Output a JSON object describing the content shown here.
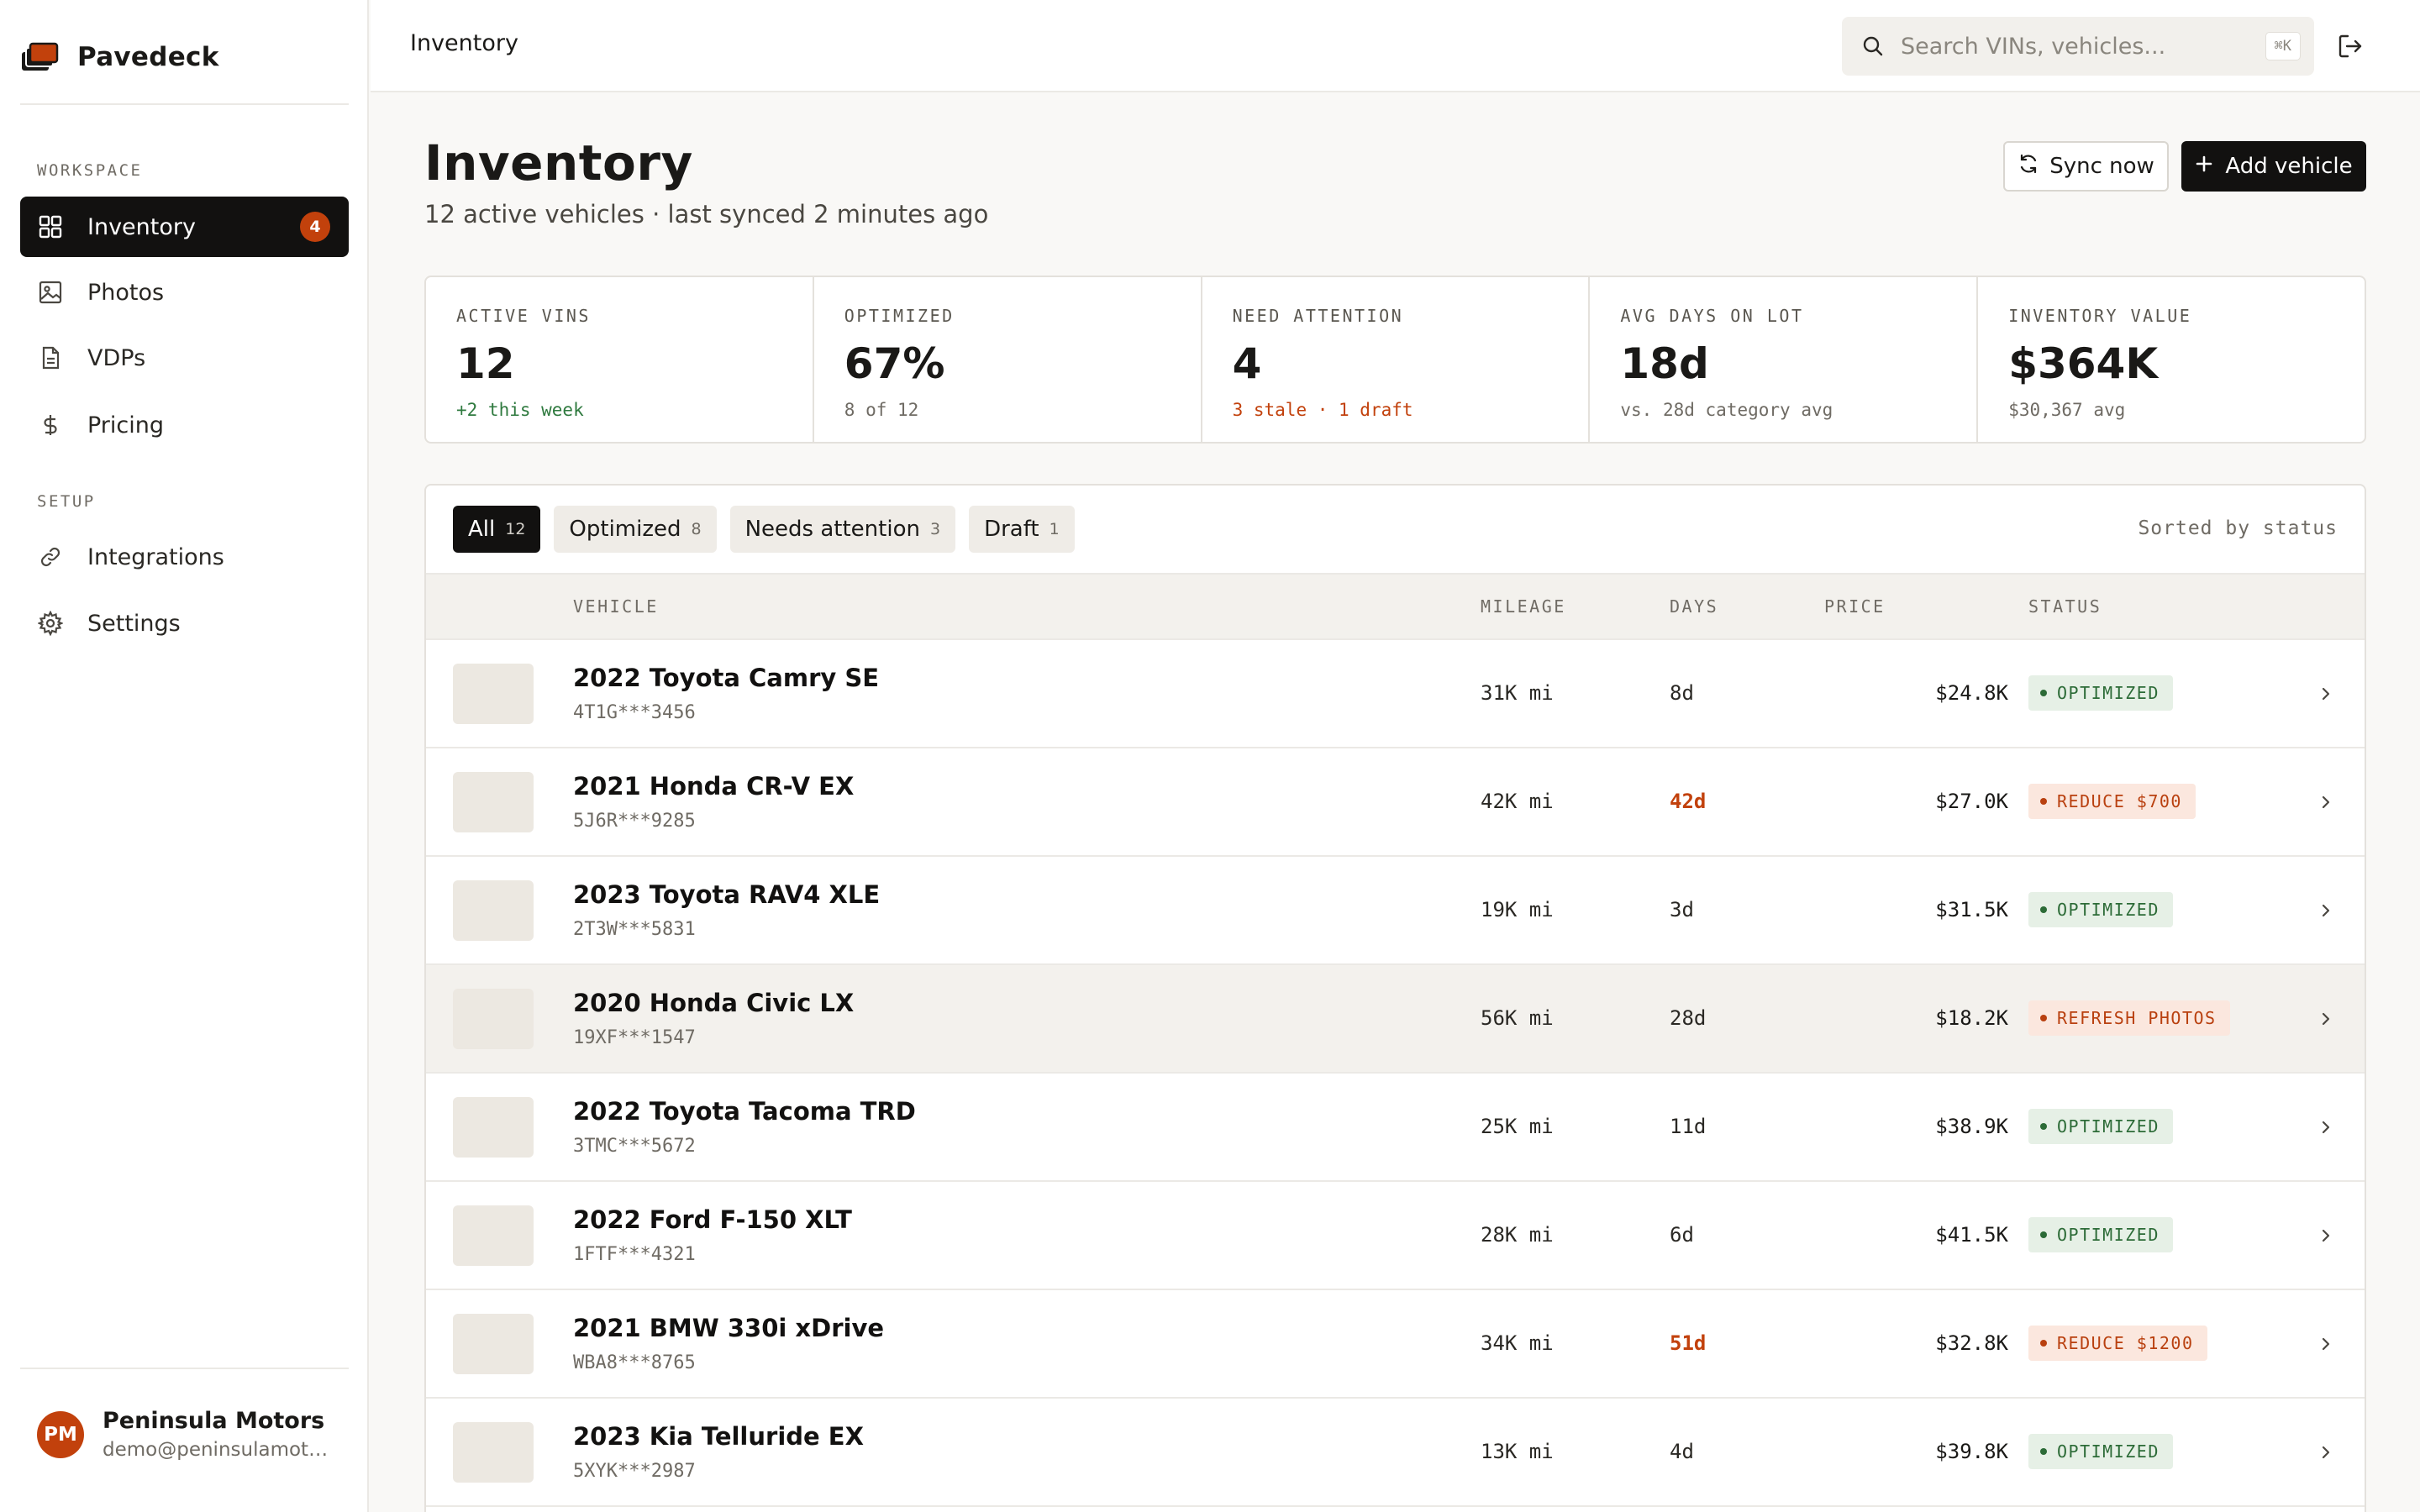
{
  "brand": {
    "name": "Pavedeck",
    "accent": "#c2410c"
  },
  "sidebar": {
    "workspace_label": "WORKSPACE",
    "setup_label": "SETUP",
    "items": [
      {
        "label": "Inventory",
        "icon": "grid-icon",
        "badge": "4",
        "active": true
      },
      {
        "label": "Photos",
        "icon": "image-icon"
      },
      {
        "label": "VDPs",
        "icon": "document-icon"
      },
      {
        "label": "Pricing",
        "icon": "dollar-icon"
      }
    ],
    "setup_items": [
      {
        "label": "Integrations",
        "icon": "link-icon"
      },
      {
        "label": "Settings",
        "icon": "gear-icon"
      }
    ],
    "account": {
      "initials": "PM",
      "name": "Peninsula Motors",
      "email": "demo@peninsulamotors.com"
    }
  },
  "topbar": {
    "breadcrumb": "Inventory",
    "search_placeholder": "Search VINs, vehicles...",
    "shortcut": "⌘K"
  },
  "header": {
    "title": "Inventory",
    "subtitle": "12 active vehicles · last synced 2 minutes ago",
    "sync_label": "Sync now",
    "add_label": "Add vehicle"
  },
  "stats": [
    {
      "label": "ACTIVE VINS",
      "value": "12",
      "sub": "+2 this week"
    },
    {
      "label": "OPTIMIZED",
      "value": "67%",
      "sub": "8 of 12"
    },
    {
      "label": "NEED ATTENTION",
      "value": "4",
      "sub": "3 stale · 1 draft"
    },
    {
      "label": "AVG DAYS ON LOT",
      "value": "18d",
      "sub": "vs. 28d category avg"
    },
    {
      "label": "INVENTORY VALUE",
      "value": "$364K",
      "sub": "$30,367 avg"
    }
  ],
  "filters": [
    {
      "label": "All",
      "count": "12",
      "active": true
    },
    {
      "label": "Optimized",
      "count": "8"
    },
    {
      "label": "Needs attention",
      "count": "3"
    },
    {
      "label": "Draft",
      "count": "1"
    }
  ],
  "sorted_label": "Sorted by status",
  "table": {
    "headers": {
      "vehicle": "VEHICLE",
      "mileage": "MILEAGE",
      "days": "DAYS",
      "price": "PRICE",
      "status": "STATUS"
    },
    "rows": [
      {
        "name": "2022 Toyota Camry SE",
        "vin": "4T1G***3456",
        "mileage": "31K mi",
        "days": "8d",
        "price": "$24.8K",
        "status": "OPTIMIZED"
      },
      {
        "name": "2021 Honda CR-V EX",
        "vin": "5J6R***9285",
        "mileage": "42K mi",
        "days": "42d",
        "price": "$27.0K",
        "status": "REDUCE $700"
      },
      {
        "name": "2023 Toyota RAV4 XLE",
        "vin": "2T3W***5831",
        "mileage": "19K mi",
        "days": "3d",
        "price": "$31.5K",
        "status": "OPTIMIZED"
      },
      {
        "name": "2020 Honda Civic LX",
        "vin": "19XF***1547",
        "mileage": "56K mi",
        "days": "28d",
        "price": "$18.2K",
        "status": "REFRESH PHOTOS"
      },
      {
        "name": "2022 Toyota Tacoma TRD",
        "vin": "3TMC***5672",
        "mileage": "25K mi",
        "days": "11d",
        "price": "$38.9K",
        "status": "OPTIMIZED"
      },
      {
        "name": "2022 Ford F-150 XLT",
        "vin": "1FTF***4321",
        "mileage": "28K mi",
        "days": "6d",
        "price": "$41.5K",
        "status": "OPTIMIZED"
      },
      {
        "name": "2021 BMW 330i xDrive",
        "vin": "WBA8***8765",
        "mileage": "34K mi",
        "days": "51d",
        "price": "$32.8K",
        "status": "REDUCE $1200"
      },
      {
        "name": "2023 Kia Telluride EX",
        "vin": "5XYK***2987",
        "mileage": "13K mi",
        "days": "4d",
        "price": "$39.8K",
        "status": "OPTIMIZED"
      }
    ]
  }
}
